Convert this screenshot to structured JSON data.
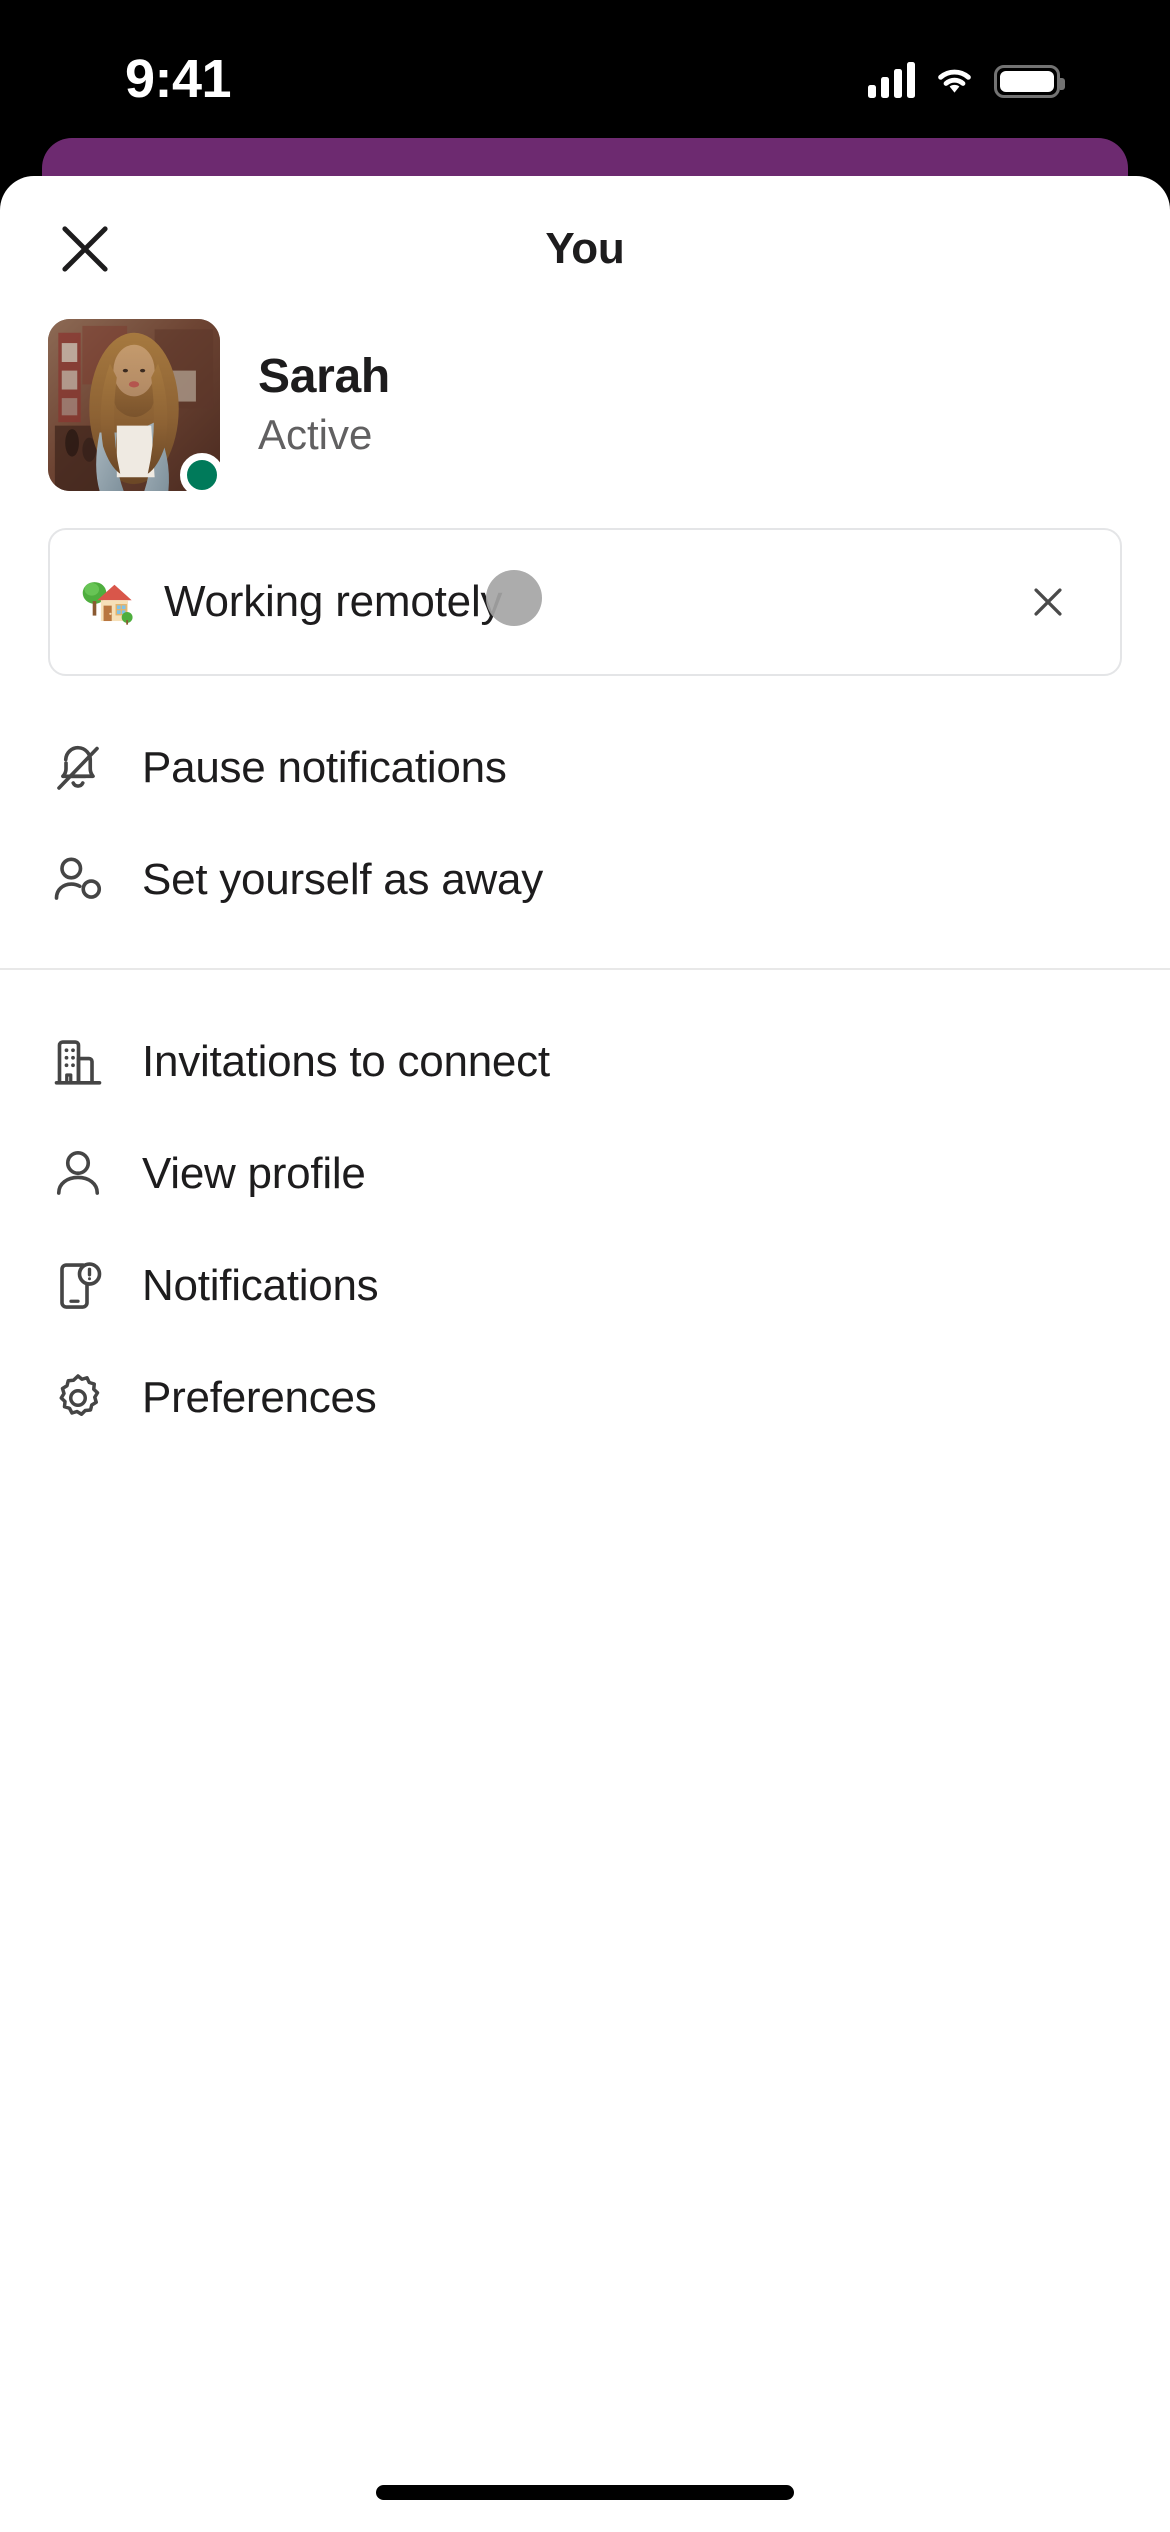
{
  "status_bar": {
    "time": "9:41",
    "cellular_icon": "signal-bars-icon",
    "wifi_icon": "wifi-icon",
    "battery_icon": "battery-full-icon"
  },
  "behind_card": {
    "color": "#6d2a70"
  },
  "sheet": {
    "title": "You",
    "close_icon": "close-icon"
  },
  "profile": {
    "name": "Sarah",
    "presence": "Active",
    "presence_color": "#007a5a",
    "avatar_icon": "avatar",
    "presence_dot_icon": "presence-active-dot-icon"
  },
  "status_field": {
    "emoji_icon": "house-with-garden-emoji",
    "emoji": "🏡",
    "text": "Working remotely",
    "clear_icon": "close-icon"
  },
  "menu": {
    "primary": [
      {
        "icon": "bell-slash-icon",
        "label": "Pause notifications"
      },
      {
        "icon": "person-away-icon",
        "label": "Set yourself as away"
      }
    ],
    "secondary": [
      {
        "icon": "building-icon",
        "label": "Invitations to connect"
      },
      {
        "icon": "person-icon",
        "label": "View profile"
      },
      {
        "icon": "mobile-bell-icon",
        "label": "Notifications"
      },
      {
        "icon": "gear-icon",
        "label": "Preferences"
      }
    ]
  },
  "overlay": {
    "tap_indicator_color": "#a5a5a5"
  },
  "home_indicator": {
    "icon": "home-indicator"
  }
}
